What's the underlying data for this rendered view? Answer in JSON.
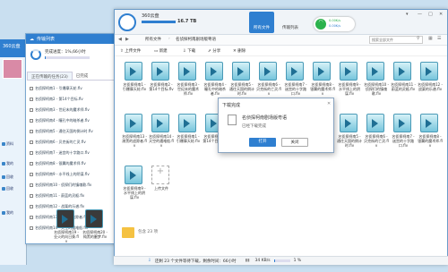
{
  "bg_window": {
    "logo": "360云盘",
    "nav": [
      "资料",
      "我的",
      "回收",
      "回收",
      "我的"
    ]
  },
  "transfer": {
    "title": "传输列表",
    "progress_text": "完成进度：1%,66小时",
    "tabs": [
      "正在传输的任务(23)",
      "已完成"
    ],
    "items": [
      "名侦探柯南1 - 引爆摩天轮.flv",
      "名侦探柯南2 - 第14个目标.flv",
      "名侦探柯南3 - 世纪末的魔术师.flv",
      "名侦探柯南4 - 瞳孔中的暗杀者.flv",
      "名侦探柯南5 - 通往天国的倒计时.flv",
      "名侦探柯南6 - 贝克街的亡灵.flv",
      "名侦探柯南7 - 迷宫的十字路口.flv",
      "名侦探柯南8 - 银翼的魔术师.flv",
      "名侦探柯南9 - 水平线上的阴谋.flv",
      "名侦探柯南10 - 侦探们的镇魂歌.flv",
      "名侦探柯南11 - 蔚蓝的灵柩.flv",
      "名侦探柯南12 - 战栗的乐谱.flv",
      "名侦探柯南13 - 漆黑的追踪者.flv",
      "名侦探柯南14 - 天空的遇难船.flv"
    ],
    "thumbs": [
      "名侦探柯南19 - 业火的向日葵.flv",
      "名侦探柯南20 - 纯黑的噩梦.flv"
    ]
  },
  "main": {
    "app_name": "360云盘",
    "quota": "16.7 TB",
    "tabs": [
      "所有文件",
      "传输列表"
    ],
    "speed_up": "0.00K/s",
    "speed_down": "0.00K/s",
    "breadcrumb": [
      "所有文件",
      "名侦探柯南剧场版粤语"
    ],
    "search_placeholder": "搜索全部文件",
    "actions": [
      "上传文件",
      "新建",
      "下载",
      "分享",
      "删除"
    ],
    "upload_tile": "上传文件",
    "folder_count": "包含 23 项"
  },
  "dialog": {
    "title": "下载完成",
    "filename": "名侦探柯南剧场版粤语",
    "message": "已经下载完成",
    "open_label": "打开",
    "close_label": "关闭"
  },
  "statusbar": {
    "text": "还剩 23 个文件等待下载，剩余时间：66小时",
    "speed": "34 KB/s",
    "percent": "1 %"
  }
}
